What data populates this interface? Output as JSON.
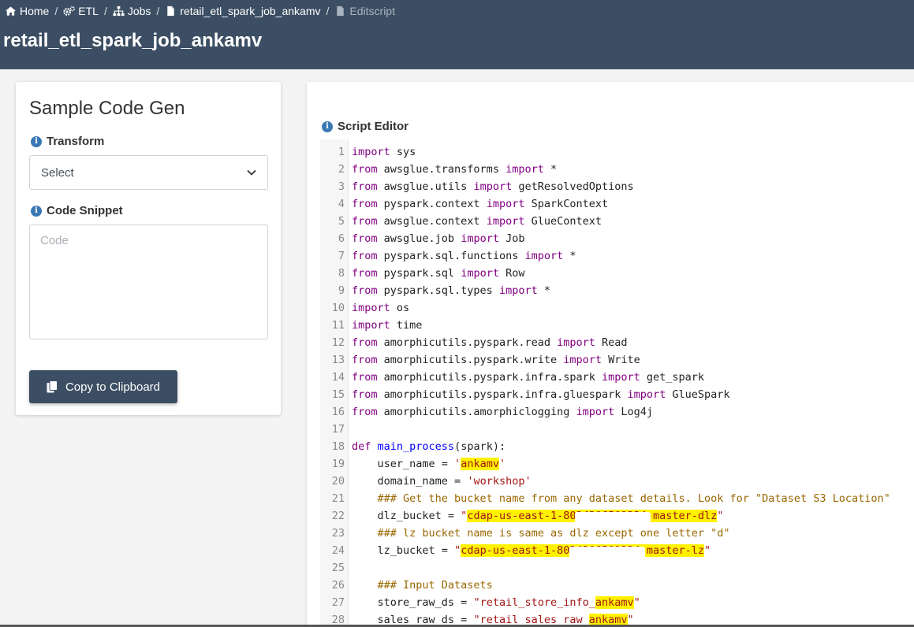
{
  "breadcrumbs": [
    {
      "label": "Home",
      "icon": "home-icon"
    },
    {
      "label": "ETL",
      "icon": "gears-icon"
    },
    {
      "label": "Jobs",
      "icon": "sitemap-icon"
    },
    {
      "label": "retail_etl_spark_job_ankamv",
      "icon": "file-icon"
    },
    {
      "label": "Editscript",
      "icon": "file-icon"
    }
  ],
  "breadcrumb_separator": "/",
  "page_title": "retail_etl_spark_job_ankamv",
  "codegen": {
    "title": "Sample Code Gen",
    "transform_label": "Transform",
    "transform_value": "Select",
    "snippet_label": "Code Snippet",
    "snippet_placeholder": "Code",
    "copy_label": "Copy to Clipboard"
  },
  "editor": {
    "label": "Script Editor",
    "lines": [
      {
        "n": "1",
        "segs": [
          [
            "kw",
            "import"
          ],
          [
            "tx",
            " sys"
          ]
        ]
      },
      {
        "n": "2",
        "segs": [
          [
            "kw",
            "from"
          ],
          [
            "tx",
            " awsglue.transforms "
          ],
          [
            "kw",
            "import"
          ],
          [
            "tx",
            " *"
          ]
        ]
      },
      {
        "n": "3",
        "segs": [
          [
            "kw",
            "from"
          ],
          [
            "tx",
            " awsglue.utils "
          ],
          [
            "kw",
            "import"
          ],
          [
            "tx",
            " getResolvedOptions"
          ]
        ]
      },
      {
        "n": "4",
        "segs": [
          [
            "kw",
            "from"
          ],
          [
            "tx",
            " pyspark.context "
          ],
          [
            "kw",
            "import"
          ],
          [
            "tx",
            " SparkContext"
          ]
        ]
      },
      {
        "n": "5",
        "segs": [
          [
            "kw",
            "from"
          ],
          [
            "tx",
            " awsglue.context "
          ],
          [
            "kw",
            "import"
          ],
          [
            "tx",
            " GlueContext"
          ]
        ]
      },
      {
        "n": "6",
        "segs": [
          [
            "kw",
            "from"
          ],
          [
            "tx",
            " awsglue.job "
          ],
          [
            "kw",
            "import"
          ],
          [
            "tx",
            " Job"
          ]
        ]
      },
      {
        "n": "7",
        "segs": [
          [
            "kw",
            "from"
          ],
          [
            "tx",
            " pyspark.sql.functions "
          ],
          [
            "kw",
            "import"
          ],
          [
            "tx",
            " *"
          ]
        ]
      },
      {
        "n": "8",
        "segs": [
          [
            "kw",
            "from"
          ],
          [
            "tx",
            " pyspark.sql "
          ],
          [
            "kw",
            "import"
          ],
          [
            "tx",
            " Row"
          ]
        ]
      },
      {
        "n": "9",
        "segs": [
          [
            "kw",
            "from"
          ],
          [
            "tx",
            " pyspark.sql.types "
          ],
          [
            "kw",
            "import"
          ],
          [
            "tx",
            " *"
          ]
        ]
      },
      {
        "n": "10",
        "segs": [
          [
            "kw",
            "import"
          ],
          [
            "tx",
            " os"
          ]
        ]
      },
      {
        "n": "11",
        "segs": [
          [
            "kw",
            "import"
          ],
          [
            "tx",
            " time"
          ]
        ]
      },
      {
        "n": "12",
        "segs": [
          [
            "kw",
            "from"
          ],
          [
            "tx",
            " amorphicutils.pyspark.read "
          ],
          [
            "kw",
            "import"
          ],
          [
            "tx",
            " Read"
          ]
        ]
      },
      {
        "n": "13",
        "segs": [
          [
            "kw",
            "from"
          ],
          [
            "tx",
            " amorphicutils.pyspark.write "
          ],
          [
            "kw",
            "import"
          ],
          [
            "tx",
            " Write"
          ]
        ]
      },
      {
        "n": "14",
        "segs": [
          [
            "kw",
            "from"
          ],
          [
            "tx",
            " amorphicutils.pyspark.infra.spark "
          ],
          [
            "kw",
            "import"
          ],
          [
            "tx",
            " get_spark"
          ]
        ]
      },
      {
        "n": "15",
        "segs": [
          [
            "kw",
            "from"
          ],
          [
            "tx",
            " amorphicutils.pyspark.infra.gluespark "
          ],
          [
            "kw",
            "import"
          ],
          [
            "tx",
            " GlueSpark"
          ]
        ]
      },
      {
        "n": "16",
        "segs": [
          [
            "kw",
            "from"
          ],
          [
            "tx",
            " amorphicutils.amorphiclogging "
          ],
          [
            "kw",
            "import"
          ],
          [
            "tx",
            " Log4j"
          ]
        ]
      },
      {
        "n": "17",
        "segs": []
      },
      {
        "n": "18",
        "segs": [
          [
            "kw",
            "def"
          ],
          [
            "tx",
            " "
          ],
          [
            "df",
            "main_process"
          ],
          [
            "tx",
            "(spark):"
          ]
        ]
      },
      {
        "n": "19",
        "segs": [
          [
            "tx",
            "    user_name = "
          ],
          [
            "st",
            "'"
          ],
          [
            "st hl",
            "ankamv"
          ],
          [
            "st",
            "'"
          ]
        ]
      },
      {
        "n": "20",
        "segs": [
          [
            "tx",
            "    domain_name = "
          ],
          [
            "st",
            "'workshop'"
          ]
        ]
      },
      {
        "n": "21",
        "segs": [
          [
            "cm",
            "    ### Get the bucket name from any dataset details. Look for \"Dataset S3 Location\""
          ]
        ]
      },
      {
        "n": "22",
        "segs": [
          [
            "tx",
            "    dlz_bucket = "
          ],
          [
            "st",
            "\""
          ],
          [
            "st hl",
            "cdap-us-east-1-8024306501234-master-dlz"
          ],
          [
            "st",
            "\""
          ]
        ]
      },
      {
        "n": "23",
        "segs": [
          [
            "cm",
            "    ### lz bucket name is same as dlz except one letter \"d\""
          ]
        ]
      },
      {
        "n": "24",
        "segs": [
          [
            "tx",
            "    lz_bucket = "
          ],
          [
            "st",
            "\""
          ],
          [
            "st hl",
            "cdap-us-east-1-8024306501234-master-lz"
          ],
          [
            "st",
            "\""
          ]
        ]
      },
      {
        "n": "25",
        "segs": []
      },
      {
        "n": "26",
        "segs": [
          [
            "cm",
            "    ### Input Datasets"
          ]
        ]
      },
      {
        "n": "27",
        "segs": [
          [
            "tx",
            "    store_raw_ds = "
          ],
          [
            "st",
            "\"retail_store_info_"
          ],
          [
            "st hl",
            "ankamv"
          ],
          [
            "st",
            "\""
          ]
        ]
      },
      {
        "n": "28",
        "segs": [
          [
            "tx",
            "    sales_raw_ds = "
          ],
          [
            "st",
            "\"retail_sales_raw_"
          ],
          [
            "st hl",
            "ankamv"
          ],
          [
            "st",
            "\""
          ]
        ]
      }
    ]
  }
}
